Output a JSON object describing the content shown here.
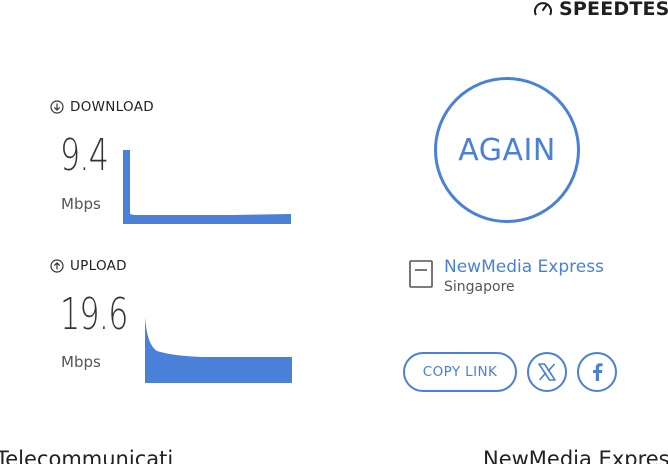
{
  "brand": {
    "icon": "gauge-icon",
    "text": "SPEEDTES"
  },
  "download": {
    "icon": "arrow-down-circle-icon",
    "label": "DOWNLOAD",
    "value": "9.4",
    "unit": "Mbps"
  },
  "upload": {
    "icon": "arrow-up-circle-icon",
    "label": "UPLOAD",
    "value": "19.6",
    "unit": "Mbps"
  },
  "again_button": {
    "label": "AGAIN"
  },
  "server": {
    "icon": "document-icon",
    "name": "NewMedia Express",
    "location": "Singapore"
  },
  "share": {
    "copy_link_label": "COPY LINK",
    "x_icon": "x-logo-icon",
    "facebook_icon": "facebook-icon"
  },
  "bottom": {
    "left_text": "Telecommunicati",
    "right_text": "NewMedia Expres"
  },
  "colors": {
    "accent": "#4a80d8",
    "text": "#333333"
  }
}
